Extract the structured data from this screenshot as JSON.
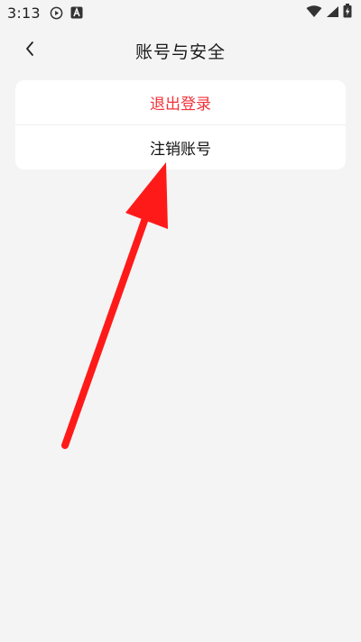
{
  "status_bar": {
    "time": "3:13",
    "left_icons": [
      "play-circle-icon",
      "notification-a-icon"
    ],
    "right_icons": [
      "wifi-icon",
      "signal-icon",
      "battery-icon"
    ]
  },
  "nav": {
    "title": "账号与安全",
    "back_icon": "chevron-left-icon"
  },
  "menu": {
    "items": [
      {
        "label": "退出登录",
        "color": "#f2323a"
      },
      {
        "label": "注销账号",
        "color": "#111111"
      }
    ]
  },
  "annotation": {
    "arrow_color": "#ff1a1a"
  }
}
